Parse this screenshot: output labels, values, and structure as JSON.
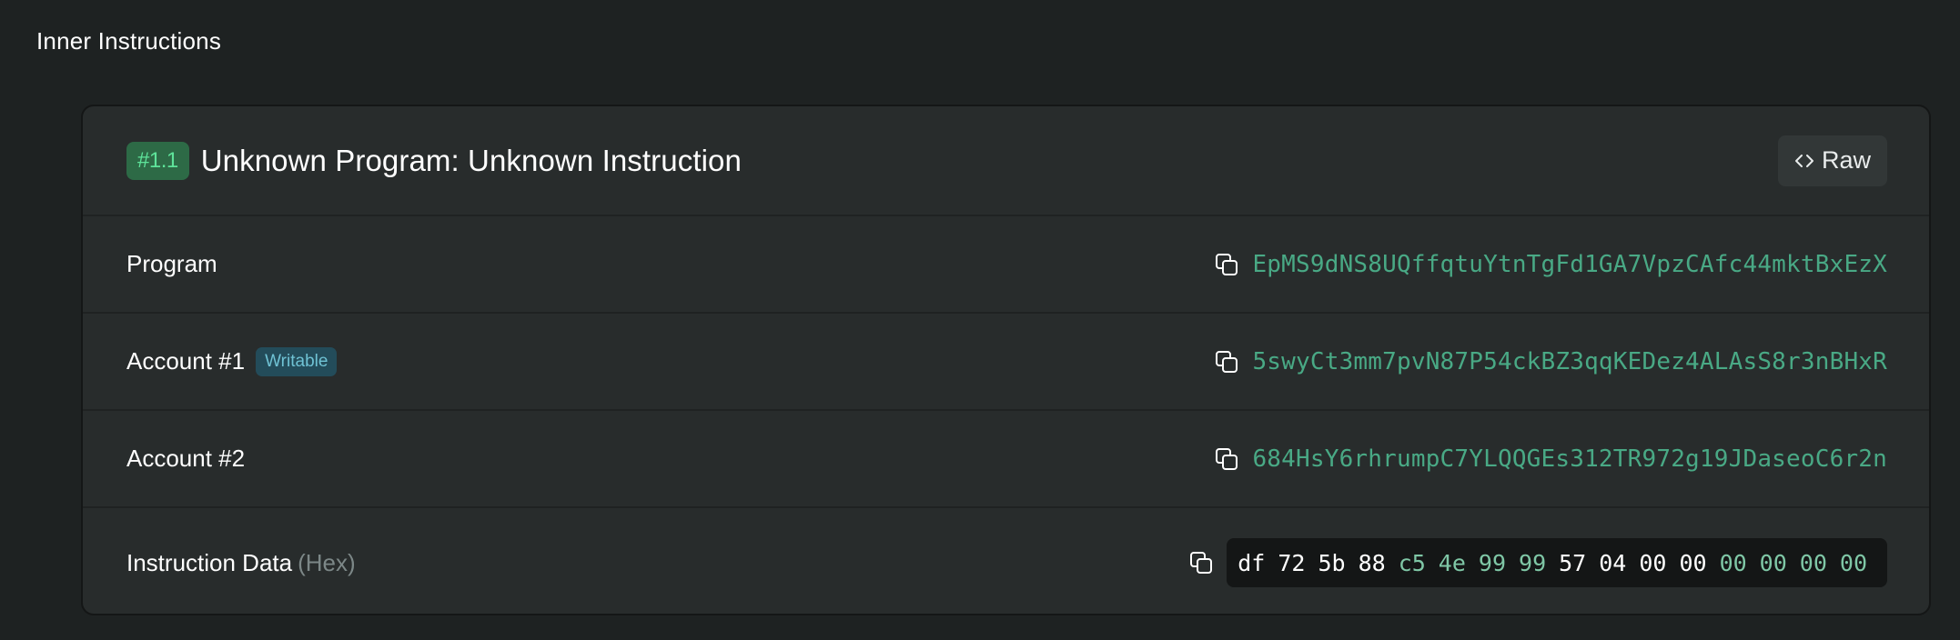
{
  "section": {
    "title": "Inner Instructions"
  },
  "instruction": {
    "index": "#1.1",
    "title": "Unknown Program: Unknown Instruction",
    "raw_label": "Raw"
  },
  "rows": [
    {
      "label": "Program",
      "badge": "",
      "value": "EpMS9dNS8UQffqtuYtnTgFd1GA7VpzCAfc44mktBxEzX"
    },
    {
      "label": "Account #1",
      "badge": "Writable",
      "value": "5swyCt3mm7pvN87P54ckBZ3qqKEDez4ALAsS8r3nBHxR"
    },
    {
      "label": "Account #2",
      "badge": "",
      "value": "684HsY6rhrumpC7YLQQGEs312TR972g19JDaseoC6r2n"
    }
  ],
  "instruction_data": {
    "label": "Instruction Data",
    "suffix": "(Hex)",
    "bytes": [
      "df",
      "72",
      "5b",
      "88",
      "c5",
      "4e",
      "99",
      "99",
      "57",
      "04",
      "00",
      "00",
      "00",
      "00",
      "00",
      "00"
    ],
    "byte_colors": [
      "w",
      "w",
      "w",
      "w",
      "g",
      "g",
      "g",
      "g",
      "w",
      "w",
      "w",
      "w",
      "g",
      "g",
      "g",
      "g"
    ]
  },
  "colors": {
    "background": "#1e2222",
    "card": "#282c2c",
    "accent_green": "#49a985",
    "badge_green": "#5ee39a",
    "writable": "#6fc2d4"
  },
  "icons": {
    "raw": "code-brackets-icon",
    "copy": "copy-icon"
  }
}
